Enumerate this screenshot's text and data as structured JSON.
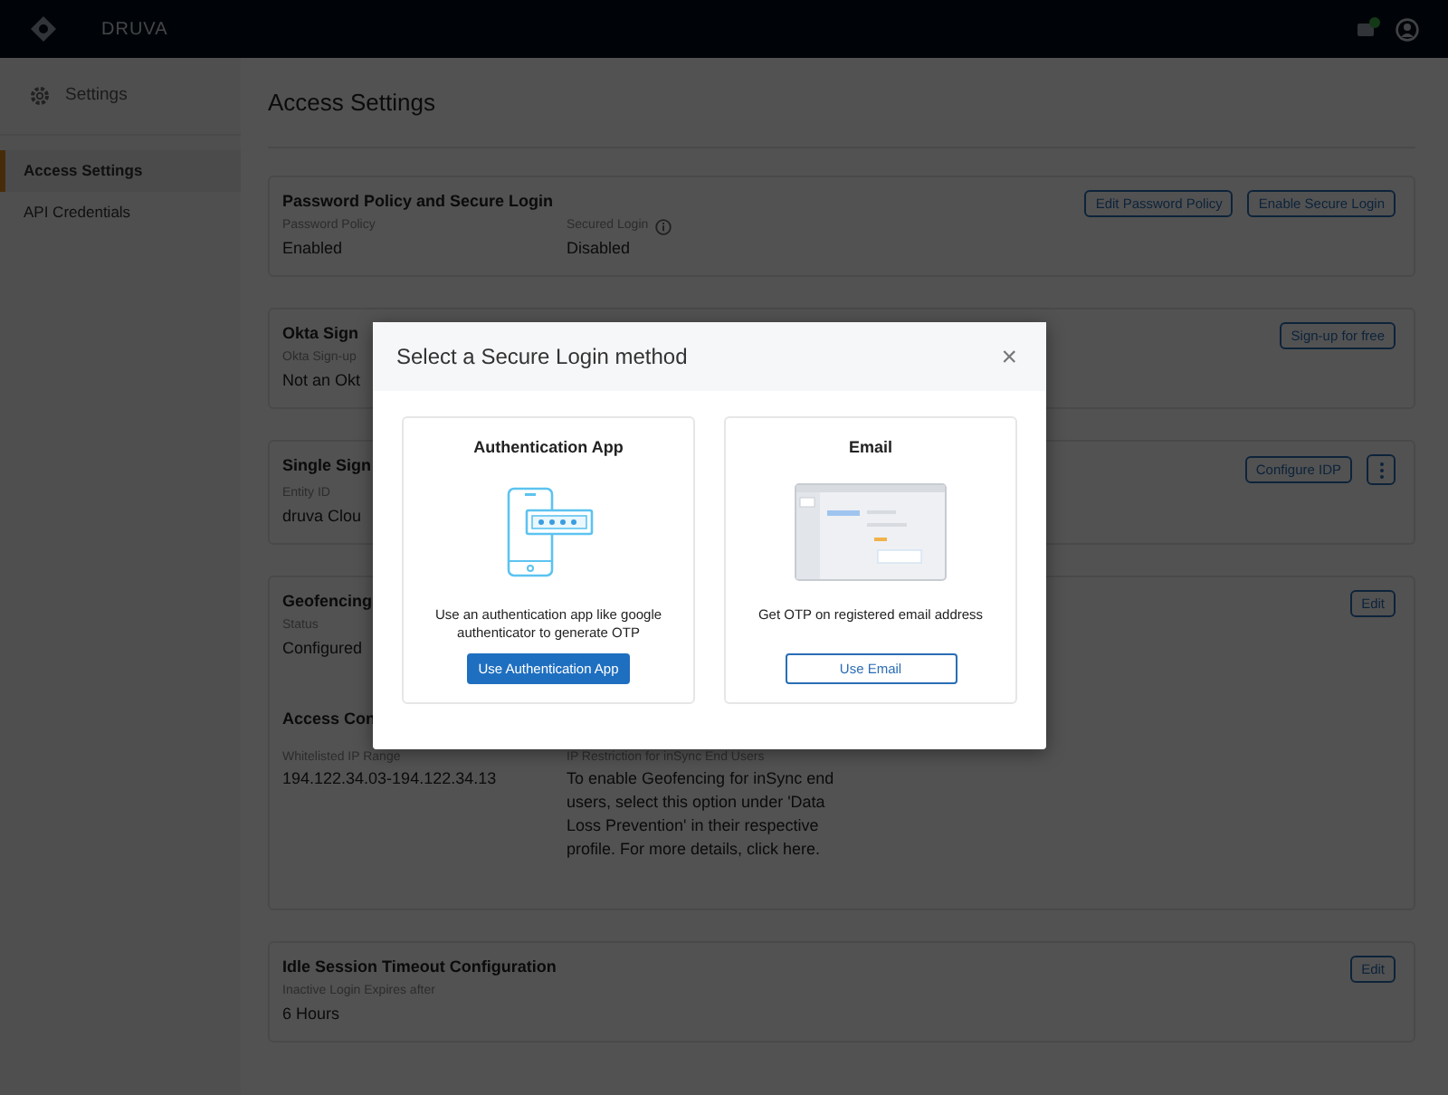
{
  "topbar": {
    "brand": "DRUVA"
  },
  "sidebar": {
    "header": "Settings",
    "items": [
      {
        "label": "Access Settings",
        "selected": true
      },
      {
        "label": "API Credentials",
        "selected": false
      }
    ]
  },
  "page_title": "Access Settings",
  "sections": [
    {
      "title": "Password Policy and Secure Login",
      "fields": [
        {
          "label": "Password Policy",
          "value": "Enabled"
        },
        {
          "label": "Secured Login",
          "value": "Disabled",
          "info": true
        }
      ],
      "buttons": [
        "Edit Password Policy",
        "Enable Secure Login"
      ]
    },
    {
      "title": "Okta Sign",
      "fields": [
        {
          "label": "Okta Sign-up",
          "value": "Not an Okt"
        }
      ],
      "buttons": [
        "Sign-up for free"
      ]
    },
    {
      "title": "Single Sign",
      "fields": [
        {
          "label": "Entity ID",
          "value": "druva Clou"
        }
      ],
      "buttons": [
        "Configure IDP"
      ],
      "menu": true
    },
    {
      "title": "Geofencing",
      "fields": [
        {
          "label": "Status",
          "value": "Configured"
        }
      ],
      "buttons": [
        "Edit"
      ],
      "subsections": [
        {
          "title": "Access Con",
          "fields": [
            {
              "label": "Whitelisted IP Range",
              "value": "194.122.34.03-194.122.34.13"
            },
            {
              "label": "IP Restriction for inSync End Users",
              "value": "To enable Geofencing for inSync end users, select this option under 'Data Loss Prevention' in their respective profile. For more details,",
              "link": "click here."
            }
          ]
        }
      ]
    },
    {
      "title": "Idle Session Timeout  Configuration",
      "fields": [
        {
          "label": "Inactive Login Expires after",
          "value": "6 Hours"
        }
      ],
      "buttons": [
        "Edit"
      ]
    }
  ],
  "modal": {
    "title": "Select a Secure Login method",
    "close": "×",
    "options": [
      {
        "kind": "app",
        "title": "Authentication App",
        "description": "Use an authentication app like google authenticator to generate OTP",
        "button": "Use Authentication App",
        "primary": true
      },
      {
        "kind": "email",
        "title": "Email",
        "description": "Get  OTP on registered email address",
        "button": "Use Email",
        "primary": false
      }
    ]
  }
}
